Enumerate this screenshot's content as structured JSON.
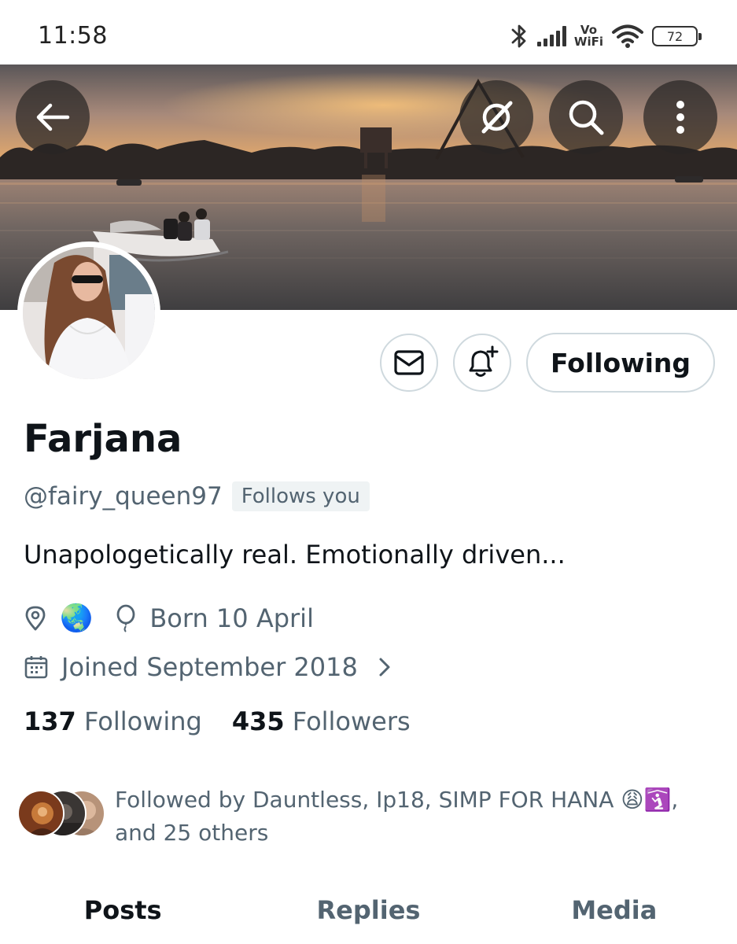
{
  "status_bar": {
    "time": "11:58",
    "network_label_top": "Vo",
    "network_label_bottom": "WiFi",
    "battery": "72"
  },
  "header": {
    "icons": [
      "back-arrow-icon",
      "grok-icon",
      "search-icon",
      "more-vertical-icon"
    ]
  },
  "profile": {
    "display_name": "Farjana",
    "handle": "@fairy_queen97",
    "follows_you_badge": "Follows you",
    "bio": "Unapologetically real. Emotionally driven...",
    "location_emoji": "🌏",
    "birthday": "Born 10 April",
    "joined": "Joined September 2018",
    "following_button": "Following"
  },
  "stats": {
    "following_count": "137",
    "following_label": "Following",
    "followers_count": "435",
    "followers_label": "Followers"
  },
  "followed_by": {
    "line1": "Followed by Dauntless, Ip18, SIMP FOR HANA 😩🛐,",
    "line2": "and 25 others"
  },
  "tabs": [
    {
      "label": "Posts",
      "active": true
    },
    {
      "label": "Replies",
      "active": false
    },
    {
      "label": "Media",
      "active": false
    }
  ],
  "colors": {
    "text_primary": "#0f1419",
    "text_secondary": "#536471",
    "border": "#cfd9de"
  }
}
